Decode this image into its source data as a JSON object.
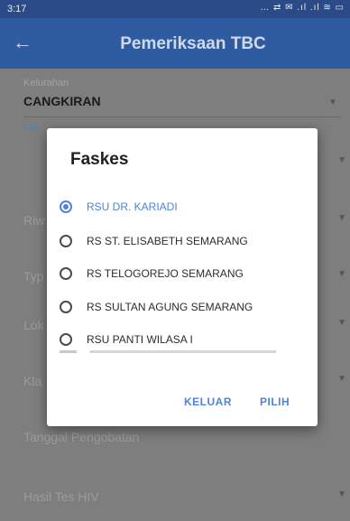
{
  "status_bar": {
    "time": "3:17",
    "icons": "… ⇄ ✉ .ıl .ıl ≋ ▭"
  },
  "app_bar": {
    "title": "Pemeriksaan TBC"
  },
  "form": {
    "kelurahan": {
      "label": "Kelurahan",
      "value": "CANGKIRAN"
    },
    "faskes_label_partial": "Fas",
    "behind_labels": [
      "Riw",
      "Typ",
      "Lok",
      "Kla"
    ],
    "tanggal_pengobatan": "Tanggal Pengobatan",
    "hasil_tes_hiv": "Hasil Tes HIV"
  },
  "dialog": {
    "title": "Faskes",
    "options": [
      {
        "label": "RSU DR. KARIADI",
        "selected": true
      },
      {
        "label": "RS ST. ELISABETH SEMARANG",
        "selected": false
      },
      {
        "label": "RS TELOGOREJO SEMARANG",
        "selected": false
      },
      {
        "label": "RS SULTAN AGUNG SEMARANG",
        "selected": false
      },
      {
        "label": "RSU PANTI WILASA I",
        "selected": false
      }
    ],
    "buttons": {
      "cancel": "KELUAR",
      "ok": "PILIH"
    }
  },
  "colors": {
    "appbar": "#2f5ba1",
    "accent": "#4e84d9",
    "scrim": "#7e7e7e"
  }
}
